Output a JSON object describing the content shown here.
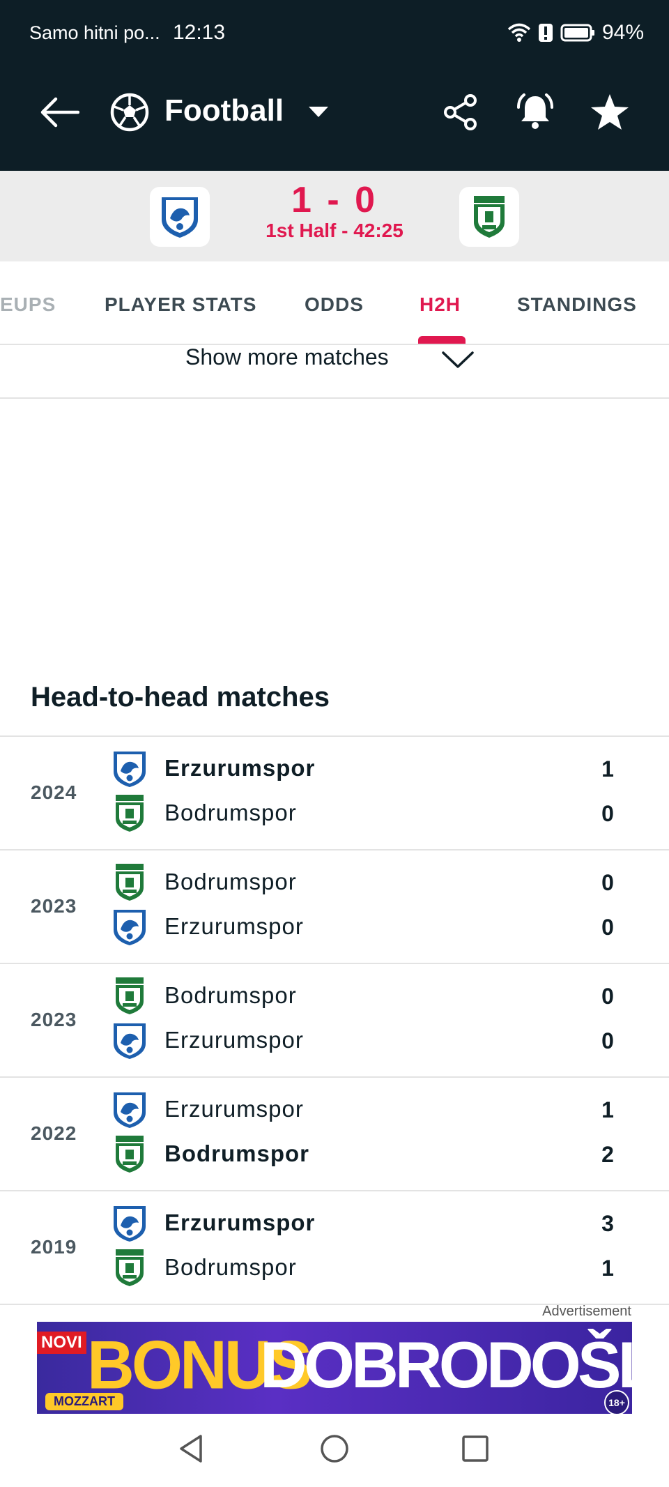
{
  "status_bar": {
    "carrier": "Samo hitni po...",
    "time": "12:13",
    "battery": "94%"
  },
  "app_bar": {
    "sport": "Football"
  },
  "match": {
    "score": "1 - 0",
    "period": "1st Half - 42:25",
    "home_team": "Erzurumspor",
    "away_team": "Bodrumspor"
  },
  "tabs": [
    {
      "label": "EUPS",
      "active": false
    },
    {
      "label": "PLAYER STATS",
      "active": false
    },
    {
      "label": "ODDS",
      "active": false
    },
    {
      "label": "H2H",
      "active": true
    },
    {
      "label": "STANDINGS",
      "active": false
    }
  ],
  "show_more": {
    "label": "Show more matches"
  },
  "h2h": {
    "title": "Head-to-head matches",
    "matches": [
      {
        "year": "2024",
        "t1": {
          "name": "Erzurumspor",
          "logo": "erzurumspor",
          "score": "1",
          "bold": true
        },
        "t2": {
          "name": "Bodrumspor",
          "logo": "bodrumspor",
          "score": "0",
          "bold": false
        }
      },
      {
        "year": "2023",
        "t1": {
          "name": "Bodrumspor",
          "logo": "bodrumspor",
          "score": "0",
          "bold": false
        },
        "t2": {
          "name": "Erzurumspor",
          "logo": "erzurumspor",
          "score": "0",
          "bold": false
        }
      },
      {
        "year": "2023",
        "t1": {
          "name": "Bodrumspor",
          "logo": "bodrumspor",
          "score": "0",
          "bold": false
        },
        "t2": {
          "name": "Erzurumspor",
          "logo": "erzurumspor",
          "score": "0",
          "bold": false
        }
      },
      {
        "year": "2022",
        "t1": {
          "name": "Erzurumspor",
          "logo": "erzurumspor",
          "score": "1",
          "bold": false
        },
        "t2": {
          "name": "Bodrumspor",
          "logo": "bodrumspor",
          "score": "2",
          "bold": true
        }
      },
      {
        "year": "2019",
        "t1": {
          "name": "Erzurumspor",
          "logo": "erzurumspor",
          "score": "3",
          "bold": true
        },
        "t2": {
          "name": "Bodrumspor",
          "logo": "bodrumspor",
          "score": "1",
          "bold": false
        }
      }
    ]
  },
  "ad": {
    "label": "Advertisement",
    "badge": "NOVI",
    "headline_1": "BONUS",
    "headline_2": "DOBRODOŠLICE",
    "brand": "MOZZART",
    "age": "18+"
  },
  "colors": {
    "header_bg": "#0d1e26",
    "accent": "#e0184f",
    "erzurumspor_blue": "#1d5fae",
    "bodrumspor_green": "#1f7a3a"
  }
}
